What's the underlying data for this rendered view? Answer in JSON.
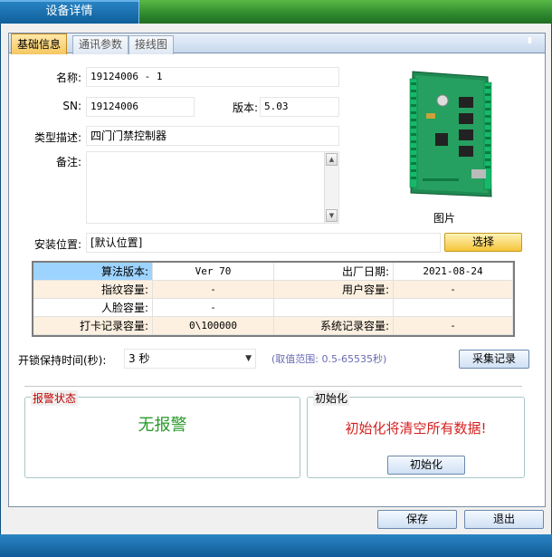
{
  "window": {
    "title": "设备详情"
  },
  "tabs": [
    {
      "label": "基础信息",
      "active": true
    },
    {
      "label": "通讯参数",
      "active": false
    },
    {
      "label": "接线图",
      "active": false
    }
  ],
  "basic": {
    "name_label": "名称:",
    "name_value": "19124006 - 1",
    "sn_label": "SN:",
    "sn_value": "19124006",
    "version_label": "版本:",
    "version_value": "5.03",
    "type_label": "类型描述:",
    "type_value": "四门门禁控制器",
    "remark_label": "备注:",
    "remark_value": "",
    "photo_caption": "图片",
    "location_label": "安装位置:",
    "location_value": "[默认位置]",
    "select_button": "选择"
  },
  "info_table": [
    {
      "k1": "算法版本:",
      "v1": "Ver 70",
      "k2": "出厂日期:",
      "v2": "2021-08-24"
    },
    {
      "k1": "指纹容量:",
      "v1": "-",
      "k2": "用户容量:",
      "v2": "-"
    },
    {
      "k1": "人脸容量:",
      "v1": "-",
      "k2": "",
      "v2": ""
    },
    {
      "k1": "打卡记录容量:",
      "v1": "0\\100000",
      "k2": "系统记录容量:",
      "v2": "-"
    }
  ],
  "unlock": {
    "label": "开锁保持时间(秒):",
    "value": "3 秒",
    "range_hint": "(取值范围: 0.5-65535秒)",
    "collect_button": "采集记录"
  },
  "alarm": {
    "title": "报警状态",
    "status": "无报警",
    "title_color": "#c00000",
    "status_color": "#2a9a2a"
  },
  "init": {
    "title": "初始化",
    "warning": "初始化将清空所有数据!",
    "button": "初始化",
    "warning_color": "#d42020"
  },
  "footer": {
    "save_button": "保存",
    "exit_button": "退出"
  },
  "colors": {
    "accent_blue": "#1f6fa8",
    "title_green": "#2e8a2e",
    "highlight_cell": "#9dd3ff"
  }
}
